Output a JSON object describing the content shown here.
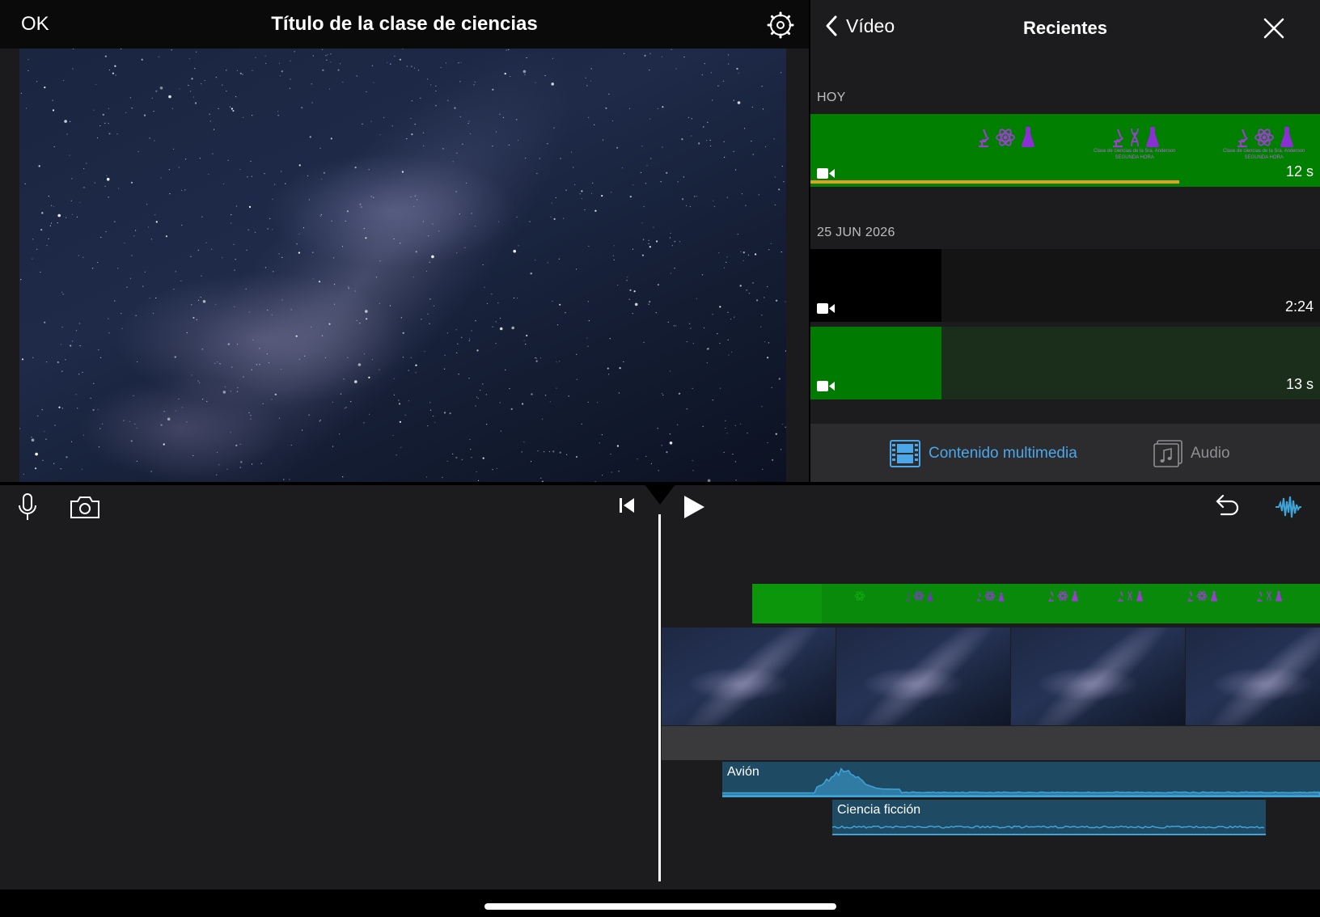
{
  "viewer": {
    "done_label": "OK",
    "project_title": "Título de la clase de ciencias"
  },
  "browser": {
    "back_label": "Vídeo",
    "title": "Recientes",
    "sections": [
      {
        "label": "HOY",
        "clips": [
          {
            "duration": "12 s",
            "thumbnail_color": "#007f00",
            "title_caption_1": "Clase de ciencias de la Sra. Anderson",
            "title_caption_2": "SEGUNDA HORA"
          }
        ]
      },
      {
        "label": "25 JUN 2026",
        "clips": [
          {
            "duration": "2:24"
          },
          {
            "duration": "13 s"
          }
        ]
      }
    ],
    "tabs": [
      {
        "label": "Contenido multimedia",
        "icon": "film-icon",
        "selected": true
      },
      {
        "label": "Audio",
        "icon": "music-note-icon",
        "selected": false
      }
    ]
  },
  "timeline": {
    "audio_clips": [
      {
        "label": "Avión"
      },
      {
        "label": "Ciencia ficción"
      }
    ]
  },
  "colors": {
    "accent": "#4aa7ea",
    "green_screen": "#007f00",
    "progress": "#e3a01b",
    "audio_clip": "#1f4a63",
    "icon_purple": "#9b3fd1"
  }
}
